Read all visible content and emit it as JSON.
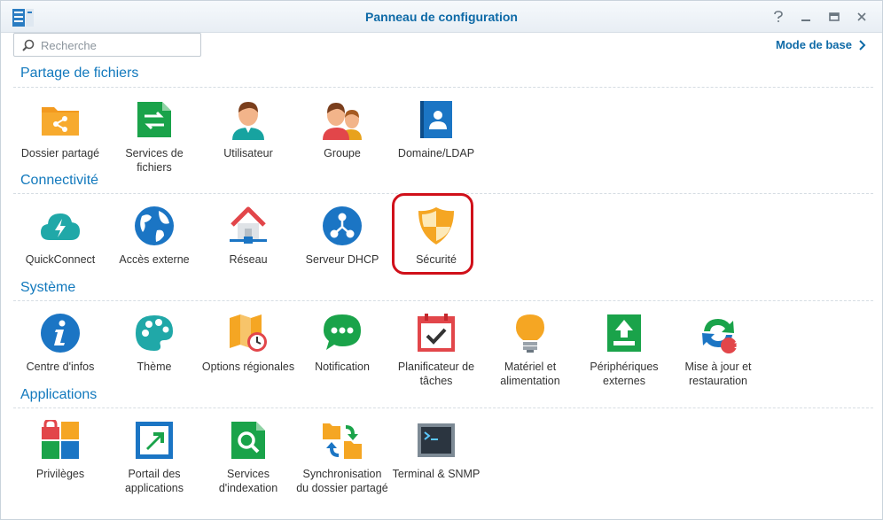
{
  "window": {
    "title": "Panneau de configuration"
  },
  "search": {
    "placeholder": "Recherche"
  },
  "mode_button": {
    "label": "Mode de base"
  },
  "sections": [
    {
      "title": "Partage de fichiers",
      "items": [
        "Dossier partagé",
        "Services de fichiers",
        "Utilisateur",
        "Groupe",
        "Domaine/LDAP"
      ]
    },
    {
      "title": "Connectivité",
      "items": [
        "QuickConnect",
        "Accès externe",
        "Réseau",
        "Serveur DHCP",
        "Sécurité"
      ]
    },
    {
      "title": "Système",
      "items": [
        "Centre d'infos",
        "Thème",
        "Options régionales",
        "Notification",
        "Planificateur de tâches",
        "Matériel et alimentation",
        "Périphériques externes",
        "Mise à jour et restauration"
      ]
    },
    {
      "title": "Applications",
      "items": [
        "Privilèges",
        "Portail des applications",
        "Services d'indexation",
        "Synchronisation du dossier partagé",
        "Terminal & SNMP"
      ]
    }
  ],
  "badges": {
    "update_count": "1"
  },
  "colors": {
    "accent": "#1279bd",
    "highlight": "#d0101a"
  }
}
